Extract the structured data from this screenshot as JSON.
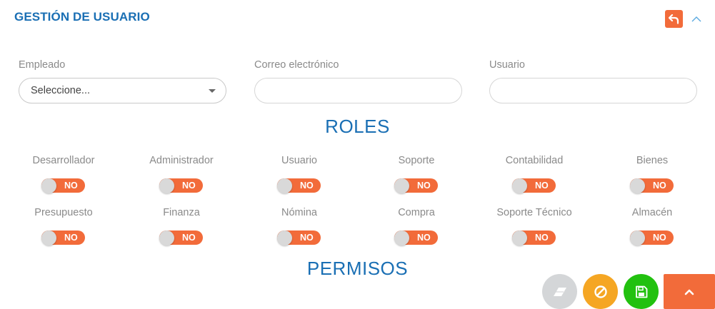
{
  "header": {
    "title": "GESTIÓN DE USUARIO",
    "back_icon": "undo-arrow-icon",
    "collapse_icon": "chevron-up-icon"
  },
  "form": {
    "empleado": {
      "label": "Empleado",
      "value": "Seleccione..."
    },
    "correo": {
      "label": "Correo electrónico",
      "value": "",
      "placeholder": ""
    },
    "usuario": {
      "label": "Usuario",
      "value": "",
      "placeholder": ""
    }
  },
  "roles": {
    "title": "ROLES",
    "items": [
      {
        "label": "Desarrollador",
        "state": "NO"
      },
      {
        "label": "Administrador",
        "state": "NO"
      },
      {
        "label": "Usuario",
        "state": "NO"
      },
      {
        "label": "Soporte",
        "state": "NO"
      },
      {
        "label": "Contabilidad",
        "state": "NO"
      },
      {
        "label": "Bienes",
        "state": "NO"
      },
      {
        "label": "Presupuesto",
        "state": "NO"
      },
      {
        "label": "Finanza",
        "state": "NO"
      },
      {
        "label": "Nómina",
        "state": "NO"
      },
      {
        "label": "Compra",
        "state": "NO"
      },
      {
        "label": "Soporte Técnico",
        "state": "NO"
      },
      {
        "label": "Almacén",
        "state": "NO"
      }
    ]
  },
  "permisos": {
    "title": "PERMISOS"
  },
  "actions": {
    "clear_icon": "eraser-icon",
    "cancel_icon": "ban-icon",
    "save_icon": "floppy-disk-icon",
    "scroll_top_icon": "chevron-up-icon"
  },
  "colors": {
    "accent_blue": "#1a6fb4",
    "toggle_off": "#f26b3a",
    "clear": "#d4d6d8",
    "cancel": "#f5a623",
    "save": "#22c10f",
    "scroll_top": "#f26b3a"
  }
}
